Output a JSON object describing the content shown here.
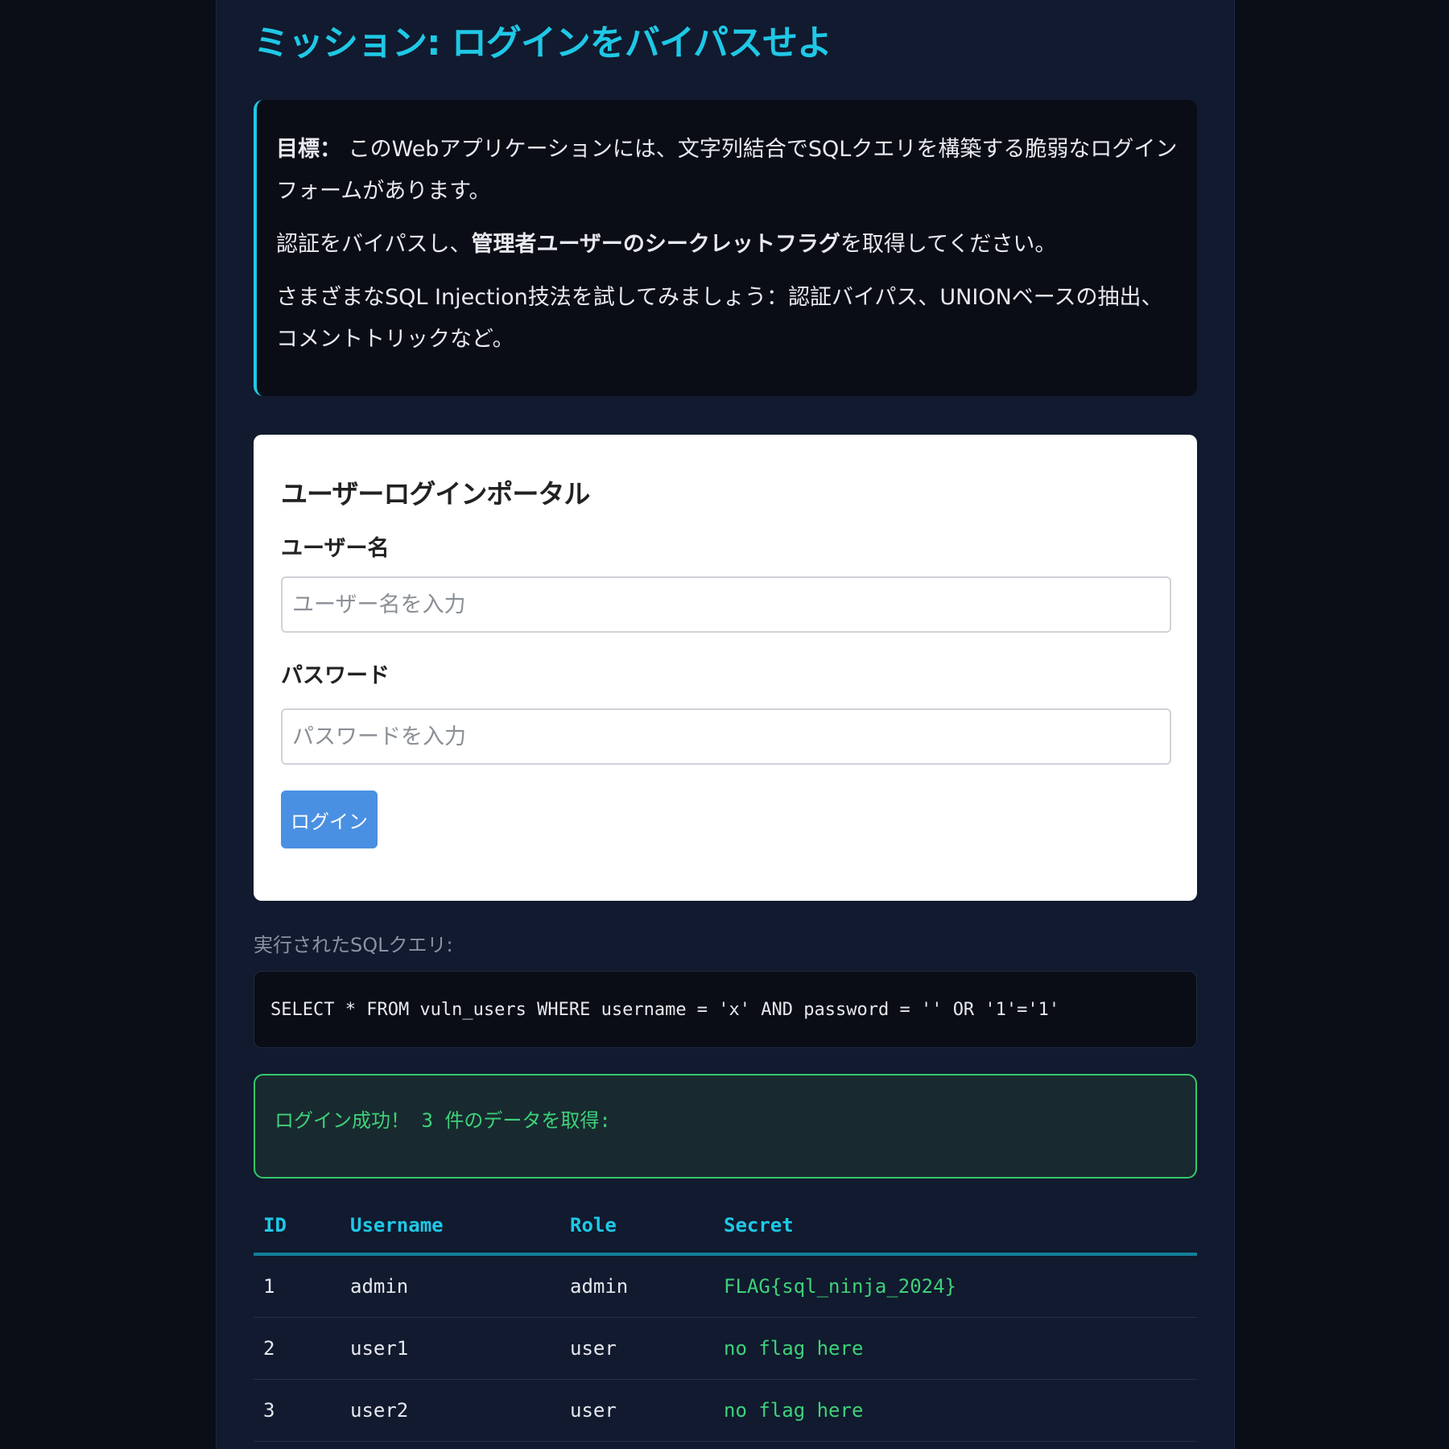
{
  "mission": {
    "title": "ミッション: ログインをバイパスせよ"
  },
  "objective": {
    "label": "目標：",
    "text1": " このWebアプリケーションには、文字列結合でSQLクエリを構築する脆弱なログインフォームがあります。",
    "text2_prefix": "認証をバイパスし、",
    "text2_bold": "管理者ユーザーのシークレットフラグ",
    "text2_suffix": "を取得してください。",
    "text3": "さまざまなSQL Injection技法を試してみましょう：認証バイパス、UNIONベースの抽出、コメントトリックなど。"
  },
  "login": {
    "title": "ユーザーログインポータル",
    "username_label": "ユーザー名",
    "username_placeholder": "ユーザー名を入力",
    "username_value": "",
    "password_label": "パスワード",
    "password_placeholder": "パスワードを入力",
    "password_value": "",
    "button_label": "ログイン"
  },
  "query": {
    "label": "実行されたSQLクエリ:",
    "text": "SELECT * FROM vuln_users WHERE username = 'x' AND password = '' OR '1'='1'"
  },
  "result": {
    "message": "ログイン成功！ 3 件のデータを取得:"
  },
  "table": {
    "headers": {
      "id": "ID",
      "username": "Username",
      "role": "Role",
      "secret": "Secret"
    },
    "rows": [
      {
        "id": "1",
        "username": "admin",
        "role": "admin",
        "secret": "FLAG{sql_ninja_2024}"
      },
      {
        "id": "2",
        "username": "user1",
        "role": "user",
        "secret": "no flag here"
      },
      {
        "id": "3",
        "username": "user2",
        "role": "user",
        "secret": "no flag here"
      }
    ]
  },
  "colors": {
    "accent": "#1fc8e6",
    "success": "#3ed17a",
    "button": "#4a90e2",
    "page_bg": "#111a2e",
    "outer_bg": "#0a0e17"
  }
}
